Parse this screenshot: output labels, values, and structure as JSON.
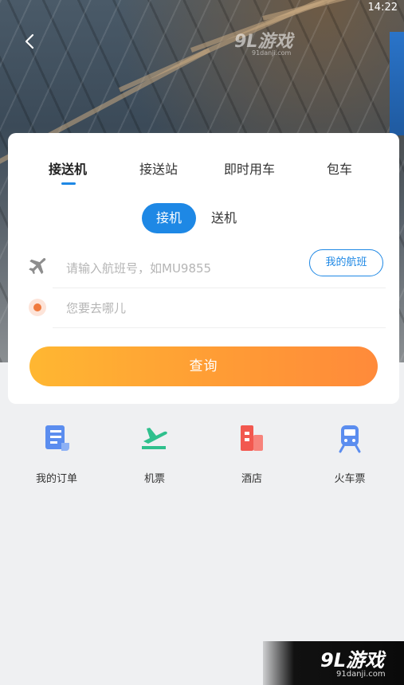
{
  "status_bar": {
    "time": "14:22"
  },
  "watermark_top": {
    "brand": "9L游戏",
    "site": "91danji.com"
  },
  "tabs": [
    {
      "label": "接送机",
      "active": true
    },
    {
      "label": "接送站",
      "active": false
    },
    {
      "label": "即时用车",
      "active": false
    },
    {
      "label": "包车",
      "active": false
    }
  ],
  "mode_switch": {
    "pickup": "接机",
    "dropoff": "送机",
    "selected": "接机"
  },
  "flight_row": {
    "icon": "airplane-icon",
    "placeholder": "请输入航班号，如MU9855",
    "my_flights_button": "我的航班"
  },
  "destination_row": {
    "icon": "location-dot-icon",
    "placeholder": "您要去哪儿"
  },
  "query_button": "查询",
  "quick_entries": [
    {
      "label": "我的订单",
      "icon": "order-scroll-icon",
      "color": "#5b8def"
    },
    {
      "label": "机票",
      "icon": "plane-ticket-icon",
      "color": "#2fc08d"
    },
    {
      "label": "酒店",
      "icon": "hotel-building-icon",
      "color": "#f2584f"
    },
    {
      "label": "火车票",
      "icon": "train-icon",
      "color": "#5b8def"
    }
  ],
  "watermark_bottom": {
    "brand": "9L游戏",
    "site": "91danji.com"
  },
  "colors": {
    "accent": "#1e88e5",
    "query_gradient_start": "#ffb732",
    "query_gradient_end": "#ff8a3a",
    "page_bg": "#eff0f2"
  }
}
